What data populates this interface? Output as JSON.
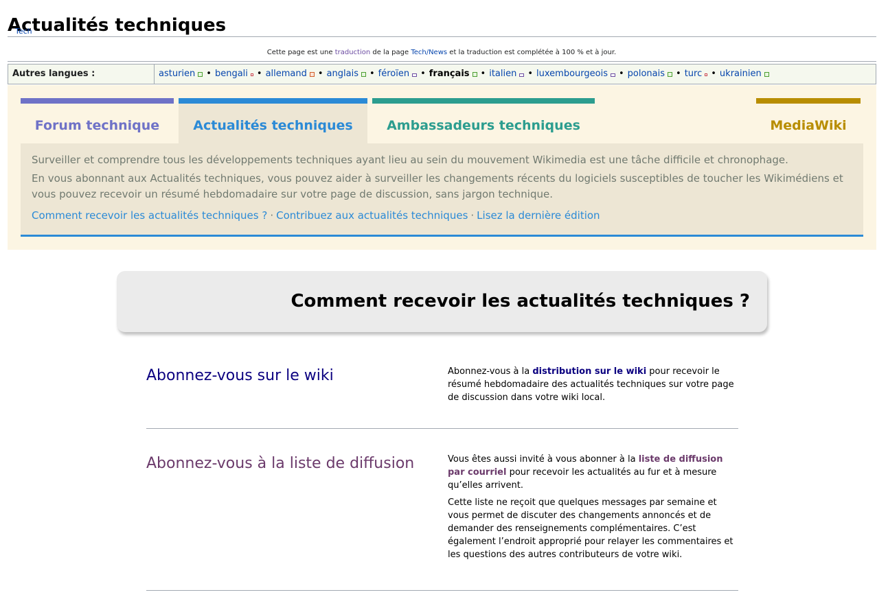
{
  "page": {
    "title": "Actualités techniques",
    "breadcrumb": "Tech",
    "translation_note": {
      "part1": "Cette page est une ",
      "link1": "traduction",
      "part2": " de la page ",
      "link2": "Tech/News",
      "part3": " et la traduction est complétée à 100 % et à jour."
    }
  },
  "languages": {
    "heading": "Autres langues :",
    "items": [
      {
        "label": "asturien",
        "status": "full"
      },
      {
        "label": "bengali",
        "status": "none"
      },
      {
        "label": "allemand",
        "status": "part"
      },
      {
        "label": "anglais",
        "status": "full"
      },
      {
        "label": "féroïen",
        "status": "mid"
      },
      {
        "label": "français",
        "status": "full",
        "current": true
      },
      {
        "label": "italien",
        "status": "mid"
      },
      {
        "label": "luxembourgeois",
        "status": "mid"
      },
      {
        "label": "polonais",
        "status": "full"
      },
      {
        "label": "turc",
        "status": "none"
      },
      {
        "label": "ukrainien",
        "status": "full"
      }
    ]
  },
  "portal": {
    "tabs": [
      {
        "label": "Forum technique",
        "color": "#6f72c7"
      },
      {
        "label": "Actualités techniques",
        "color": "#2b8ad6",
        "active": true
      },
      {
        "label": "Ambassadeurs techniques",
        "color": "#2c9d8f"
      },
      {
        "label": "MediaWiki",
        "color": "#b88d00"
      }
    ],
    "intro1": "Surveiller et comprendre tous les développements techniques ayant lieu au sein du mouvement Wikimedia est une tâche difficile et chronophage.",
    "intro2": "En vous abonnant aux Actualités techniques, vous pouvez aider à surveiller les changements récents du logiciels susceptibles de toucher les Wikimédiens et vous pouvez recevoir un résumé hebdomadaire sur votre page de discussion, sans jargon technique.",
    "links": [
      "Comment recevoir les actualités techniques ?",
      "Contribuez aux actualités techniques",
      "Lisez la dernière édition"
    ]
  },
  "main": {
    "heading": "Comment recevoir les actualités techniques ?",
    "sections": [
      {
        "title": "Abonnez-vous sur le wiki",
        "pre": "Abonnez-vous à la ",
        "link": "distribution sur le wiki",
        "post": " pour recevoir le résumé hebdomadaire des actualités techniques sur votre page de discussion dans votre wiki local."
      },
      {
        "title": "Abonnez-vous à la liste de diffusion",
        "pre": "Vous êtes aussi invité à vous abonner à la ",
        "link": "liste de diffusion par courriel",
        "post": " pour recevoir les actualités au fur et à mesure qu’elles arrivent.",
        "extra": "Cette liste ne reçoit que quelques messages par semaine et vous permet de discuter des changements annoncés et de demander des renseignements complémentaires. C’est également l’endroit approprié pour relayer les commentaires et les questions des autres contributeurs de votre wiki."
      }
    ]
  }
}
